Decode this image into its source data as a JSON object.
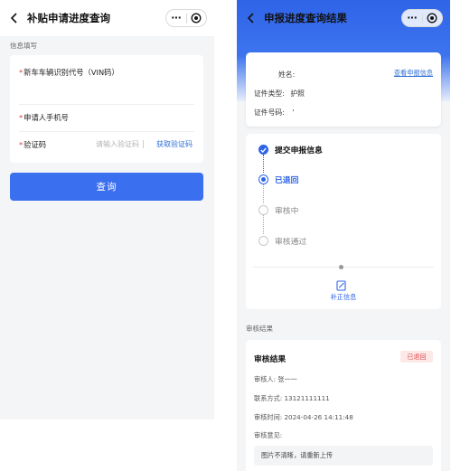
{
  "left_screen": {
    "title": "补贴申请进度查询",
    "capsule_more": "···",
    "section_label": "信息填写",
    "fields": {
      "vin": {
        "required": "*",
        "label": "新车车辆识别代号（VIN码）"
      },
      "phone": {
        "required": "*",
        "label": "申请人手机号"
      },
      "code": {
        "required": "*",
        "label": "验证码",
        "placeholder": "请输入验证码",
        "link": "获取验证码"
      }
    },
    "query_button": "查询"
  },
  "right_screen": {
    "title": "申报进度查询结果",
    "capsule_more": "···",
    "info": {
      "name_label": "姓名:",
      "view_link": "查看申报信息",
      "id_type_label": "证件类型:",
      "id_type_value": "护照",
      "id_no_label": "证件号码:",
      "id_no_value": "'"
    },
    "steps": [
      {
        "label": "提交申报信息",
        "state": "done"
      },
      {
        "label": "已退回",
        "state": "current"
      },
      {
        "label": "审核中",
        "state": "todo"
      },
      {
        "label": "审核通过",
        "state": "todo"
      }
    ],
    "action_label": "补正信息",
    "result_section_label": "审核结果",
    "result": {
      "title": "审核结果",
      "badge": "已退回",
      "reviewer": "审核人:  张一一",
      "contact": "联系方式:  13121111111",
      "time": "审核时间:  2024-04-26 14:11:48",
      "opinion_label": "审核意见:",
      "opinion": "图片不清晰，请重新上传"
    }
  },
  "colors": {
    "accent": "#2f64e8",
    "button": "#3a6ff0",
    "link": "#2f6fd6",
    "required": "#e53935",
    "badge_bg": "#fde8e8",
    "badge_text": "#e04848"
  }
}
